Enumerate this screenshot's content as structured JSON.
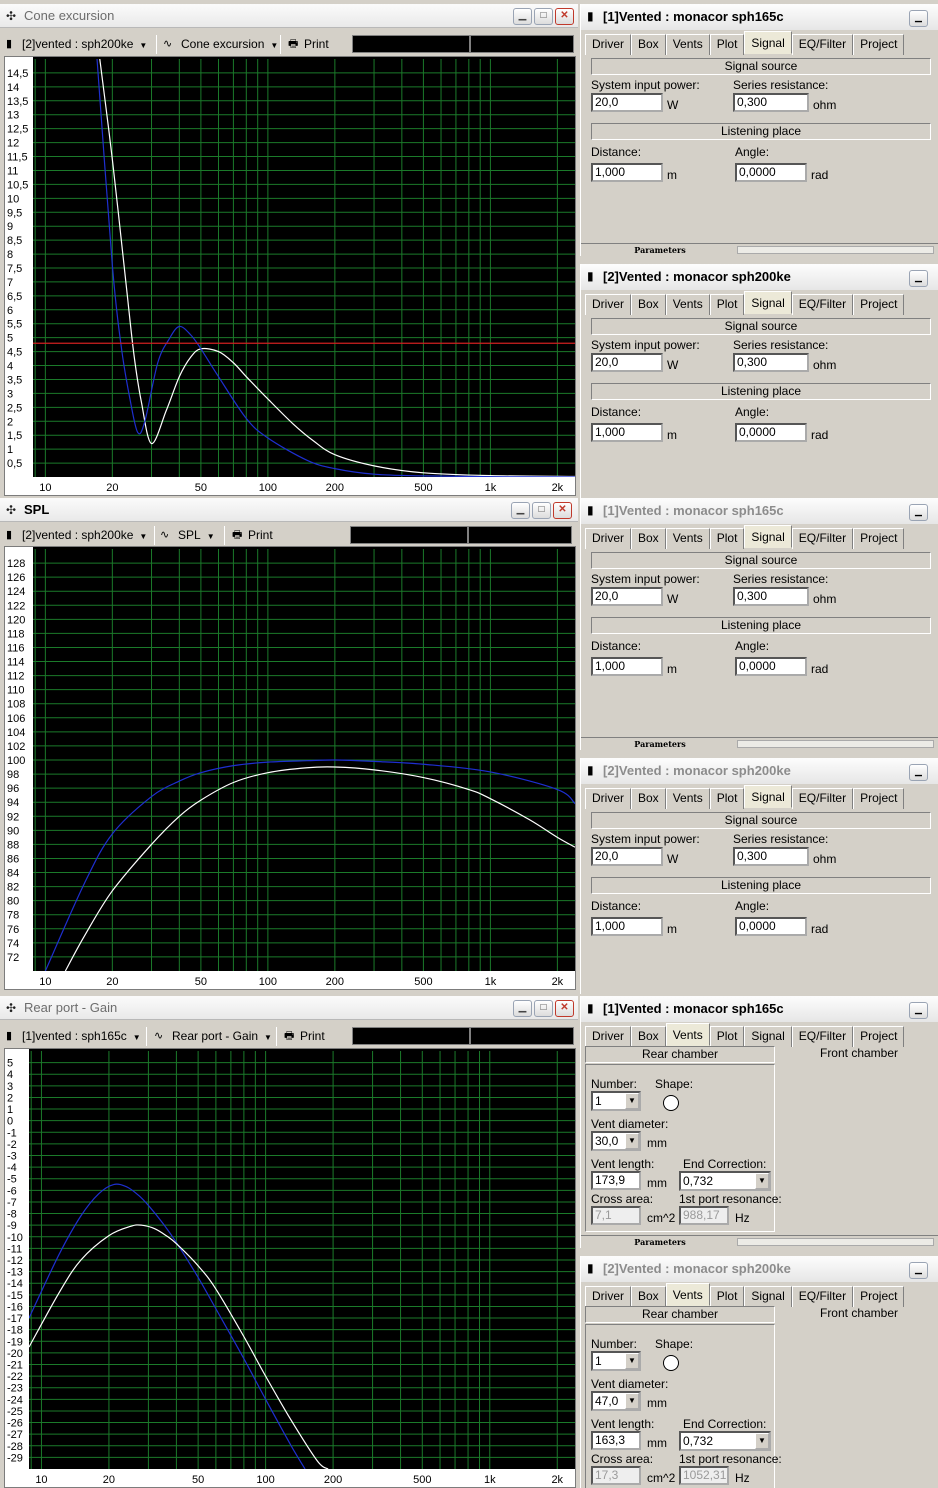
{
  "charts": {
    "cone": {
      "title": "Cone excursion",
      "driver_select": "[2]vented : sph200ke",
      "graph_select": "Cone excursion",
      "print": "Print",
      "icon": "drag-handle-icon"
    },
    "spl": {
      "title": "SPL",
      "driver_select": "[2]vented : sph200ke",
      "graph_select": "SPL",
      "print": "Print",
      "icon": "drag-handle-icon"
    },
    "port": {
      "title": "Rear port - Gain",
      "driver_select": "[1]vented : sph165c",
      "graph_select": "Rear port - Gain",
      "print": "Print",
      "icon": "drag-handle-icon"
    }
  },
  "chart_data": [
    {
      "type": "line",
      "title": "",
      "x_scale": "log",
      "x_ticks": [
        "10",
        "20",
        "50",
        "100",
        "200",
        "500",
        "1k",
        "2k"
      ],
      "x_tick_values": [
        10,
        20,
        50,
        100,
        200,
        500,
        1000,
        2000
      ],
      "y_ticks": [
        "14,5",
        "14",
        "13,5",
        "13",
        "12,5",
        "12",
        "11,5",
        "11",
        "10,5",
        "10",
        "9,5",
        "9",
        "8,5",
        "8",
        "7,5",
        "7",
        "6,5",
        "6",
        "5,5",
        "5",
        "4,5",
        "4",
        "3,5",
        "3",
        "2,5",
        "2",
        "1,5",
        "1",
        "0,5"
      ],
      "ylim": [
        0,
        15
      ],
      "xlim": [
        8.8,
        2400
      ],
      "grid": true,
      "series": [
        {
          "color": "#ffffff",
          "x": [
            17.5,
            20,
            23,
            25,
            27,
            30,
            35,
            40,
            45,
            50,
            60,
            70,
            80,
            100,
            130,
            160,
            200,
            300,
            500,
            1000,
            2400
          ],
          "y": [
            15.1,
            11.4,
            7.0,
            4.4,
            2.7,
            1.2,
            2.4,
            3.6,
            4.3,
            4.6,
            4.5,
            4.1,
            3.6,
            2.8,
            1.9,
            1.3,
            0.8,
            0.4,
            0.15,
            0.05,
            0.02
          ]
        },
        {
          "color": "#1e2fd0",
          "x": [
            17,
            20,
            22,
            24,
            26,
            28,
            32,
            36,
            40,
            45,
            50,
            60,
            80,
            100,
            150,
            200,
            300,
            500,
            1000,
            2400
          ],
          "y": [
            15.2,
            7.6,
            4.6,
            2.8,
            1.6,
            2.0,
            4.1,
            4.95,
            5.4,
            5.1,
            4.6,
            3.6,
            2.1,
            1.4,
            0.6,
            0.3,
            0.1,
            0.04,
            0.01,
            0.0
          ]
        },
        {
          "color": "#d02020",
          "x": [
            8.8,
            2400
          ],
          "y": [
            4.8,
            4.8
          ]
        }
      ]
    },
    {
      "type": "line",
      "title": "",
      "x_scale": "log",
      "x_ticks": [
        "10",
        "20",
        "50",
        "100",
        "200",
        "500",
        "1k",
        "2k"
      ],
      "x_tick_values": [
        10,
        20,
        50,
        100,
        200,
        500,
        1000,
        2000
      ],
      "y_ticks": [
        "128",
        "126",
        "124",
        "122",
        "120",
        "118",
        "116",
        "114",
        "112",
        "110",
        "108",
        "106",
        "104",
        "102",
        "100",
        "98",
        "96",
        "94",
        "92",
        "90",
        "88",
        "86",
        "84",
        "82",
        "80",
        "78",
        "76",
        "74",
        "72"
      ],
      "ylim": [
        70,
        130
      ],
      "xlim": [
        8.8,
        2400
      ],
      "grid": true,
      "series": [
        {
          "color": "#1e2fd0",
          "x": [
            10,
            15,
            20,
            30,
            40,
            50,
            70,
            100,
            150,
            200,
            300,
            500,
            1000,
            2000,
            2400
          ],
          "y": [
            70.0,
            82.5,
            89.5,
            94.8,
            97.0,
            98.2,
            99.2,
            99.7,
            99.9,
            100.0,
            99.8,
            99.4,
            98.3,
            95.8,
            93.8
          ]
        },
        {
          "color": "#ffffff",
          "x": [
            12.3,
            15,
            20,
            30,
            40,
            50,
            70,
            100,
            150,
            200,
            300,
            500,
            800,
            1000,
            1500,
            2000,
            2400
          ],
          "y": [
            70.0,
            75.0,
            81.4,
            88.0,
            92.0,
            94.3,
            96.8,
            98.2,
            98.9,
            99.0,
            98.6,
            97.5,
            95.8,
            94.5,
            91.5,
            89.0,
            87.6
          ]
        }
      ]
    },
    {
      "type": "line",
      "title": "",
      "x_scale": "log",
      "x_ticks": [
        "10",
        "20",
        "50",
        "100",
        "200",
        "500",
        "1k",
        "2k"
      ],
      "x_tick_values": [
        10,
        20,
        50,
        100,
        200,
        500,
        1000,
        2000
      ],
      "y_ticks": [
        "5",
        "4",
        "3",
        "2",
        "1",
        "0",
        "-1",
        "-2",
        "-3",
        "-4",
        "-5",
        "-6",
        "-7",
        "-8",
        "-9",
        "-10",
        "-11",
        "-12",
        "-13",
        "-14",
        "-15",
        "-16",
        "-17",
        "-18",
        "-19",
        "-20",
        "-21",
        "-22",
        "-23",
        "-24",
        "-25",
        "-26",
        "-27",
        "-28",
        "-29"
      ],
      "ylim": [
        -30,
        6
      ],
      "xlim": [
        8.8,
        2400
      ],
      "grid": true,
      "series": [
        {
          "color": "#1e2fd0",
          "x": [
            8.8,
            12,
            15,
            18,
            21,
            24,
            27,
            30,
            35,
            40,
            50,
            60,
            80,
            100,
            130,
            150
          ],
          "y": [
            -17.0,
            -11.5,
            -8.2,
            -6.3,
            -5.5,
            -5.7,
            -6.4,
            -7.3,
            -8.9,
            -10.5,
            -13.5,
            -16.2,
            -20.5,
            -24.0,
            -28.0,
            -30.0
          ]
        },
        {
          "color": "#ffffff",
          "x": [
            8.8,
            12,
            15,
            20,
            25,
            28,
            32,
            36,
            40,
            50,
            60,
            80,
            100,
            130,
            170,
            190
          ],
          "y": [
            -19.5,
            -14.8,
            -12.0,
            -9.9,
            -9.1,
            -9.0,
            -9.3,
            -9.9,
            -10.6,
            -12.5,
            -14.5,
            -18.6,
            -22.0,
            -25.8,
            -29.3,
            -30.0
          ]
        }
      ]
    }
  ],
  "panels": [
    {
      "title": "[1]Vented : monacor sph165c",
      "active": true,
      "type": "signal",
      "tabs": [
        "Driver",
        "Box",
        "Vents",
        "Plot",
        "Signal",
        "EQ/Filter",
        "Project"
      ],
      "selected": "Signal",
      "signal_source": "Signal source",
      "power_label": "System input power:",
      "power": "20,0",
      "power_unit": "W",
      "series_label": "Series resistance:",
      "series": "0,300",
      "series_unit": "ohm",
      "listening": "Listening place",
      "distance_label": "Distance:",
      "distance": "1,000",
      "distance_unit": "m",
      "angle_label": "Angle:",
      "angle": "0,0000",
      "angle_unit": "rad",
      "footer": "Parameters",
      "icon": "panel-icon"
    },
    {
      "title": "[2]Vented : monacor sph200ke",
      "active": true,
      "type": "signal",
      "tabs": [
        "Driver",
        "Box",
        "Vents",
        "Plot",
        "Signal",
        "EQ/Filter",
        "Project"
      ],
      "selected": "Signal",
      "signal_source": "Signal source",
      "power_label": "System input power:",
      "power": "20,0",
      "power_unit": "W",
      "series_label": "Series resistance:",
      "series": "0,300",
      "series_unit": "ohm",
      "listening": "Listening place",
      "distance_label": "Distance:",
      "distance": "1,000",
      "distance_unit": "m",
      "angle_label": "Angle:",
      "angle": "0,0000",
      "angle_unit": "rad",
      "footer": "",
      "icon": "panel-icon"
    },
    {
      "title": "[1]Vented : monacor sph165c",
      "active": false,
      "type": "signal",
      "tabs": [
        "Driver",
        "Box",
        "Vents",
        "Plot",
        "Signal",
        "EQ/Filter",
        "Project"
      ],
      "selected": "Signal",
      "signal_source": "Signal source",
      "power_label": "System input power:",
      "power": "20,0",
      "power_unit": "W",
      "series_label": "Series resistance:",
      "series": "0,300",
      "series_unit": "ohm",
      "listening": "Listening place",
      "distance_label": "Distance:",
      "distance": "1,000",
      "distance_unit": "m",
      "angle_label": "Angle:",
      "angle": "0,0000",
      "angle_unit": "rad",
      "footer": "Parameters",
      "icon": "panel-icon"
    },
    {
      "title": "[2]Vented : monacor sph200ke",
      "active": false,
      "type": "signal",
      "tabs": [
        "Driver",
        "Box",
        "Vents",
        "Plot",
        "Signal",
        "EQ/Filter",
        "Project"
      ],
      "selected": "Signal",
      "signal_source": "Signal source",
      "power_label": "System input power:",
      "power": "20,0",
      "power_unit": "W",
      "series_label": "Series resistance:",
      "series": "0,300",
      "series_unit": "ohm",
      "listening": "Listening place",
      "distance_label": "Distance:",
      "distance": "1,000",
      "distance_unit": "m",
      "angle_label": "Angle:",
      "angle": "0,0000",
      "angle_unit": "rad",
      "footer": "",
      "icon": "panel-icon"
    },
    {
      "title": "[1]Vented : monacor sph165c",
      "active": true,
      "type": "vents",
      "tabs": [
        "Driver",
        "Box",
        "Vents",
        "Plot",
        "Signal",
        "EQ/Filter",
        "Project"
      ],
      "selected": "Vents",
      "rear": "Rear chamber",
      "front": "Front chamber",
      "number_label": "Number:",
      "number": "1",
      "shape_label": "Shape:",
      "diam_label": "Vent diameter:",
      "diam": "30,0",
      "diam_unit": "mm",
      "length_label": "Vent length:",
      "length": "173,9",
      "length_unit": "mm",
      "endcorr_label": "End Correction:",
      "endcorr": "0,732",
      "cross_label": "Cross area:",
      "cross": "7,1",
      "cross_unit": "cm^2",
      "res_label": "1st port resonance:",
      "res": "988,17",
      "res_unit": "Hz",
      "footer": "Parameters",
      "icon": "panel-icon"
    },
    {
      "title": "[2]Vented : monacor sph200ke",
      "active": false,
      "type": "vents",
      "tabs": [
        "Driver",
        "Box",
        "Vents",
        "Plot",
        "Signal",
        "EQ/Filter",
        "Project"
      ],
      "selected": "Vents",
      "rear": "Rear chamber",
      "front": "Front chamber",
      "number_label": "Number:",
      "number": "1",
      "shape_label": "Shape:",
      "diam_label": "Vent diameter:",
      "diam": "47,0",
      "diam_unit": "mm",
      "length_label": "Vent length:",
      "length": "163,3",
      "length_unit": "mm",
      "endcorr_label": "End Correction:",
      "endcorr": "0,732",
      "cross_label": "Cross area:",
      "cross": "17,3",
      "cross_unit": "cm^2",
      "res_label": "1st port resonance:",
      "res": "1052,31",
      "res_unit": "Hz",
      "footer": "",
      "icon": "panel-icon"
    }
  ]
}
